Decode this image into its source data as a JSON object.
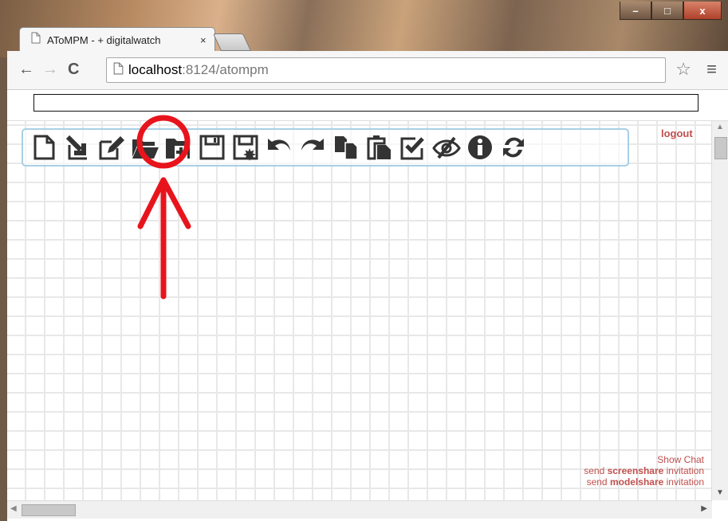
{
  "browser": {
    "tab_title": "AToMPM - + digitalwatch",
    "tab_close": "×",
    "url_host": "localhost",
    "url_path": ":8124/atompm",
    "window_controls": [
      "–",
      "□",
      "x"
    ]
  },
  "nav": {
    "back": "←",
    "forward": "→",
    "reload": "C",
    "star": "☆",
    "menu": "≡"
  },
  "toolbar_icons": [
    "new-model-icon",
    "load-into-icon",
    "edit-icon",
    "open-folder-icon",
    "new-folder-icon",
    "save-icon",
    "save-as-icon",
    "undo-icon",
    "redo-icon",
    "copy-icon",
    "paste-icon",
    "validate-icon",
    "hide-icon",
    "info-icon",
    "refresh-icon"
  ],
  "app": {
    "logout": "logout",
    "show_chat": "Show Chat",
    "screenshare_prefix": "send ",
    "screenshare_bold": "screenshare",
    "screenshare_suffix": " invitation",
    "modelshare_prefix": "send ",
    "modelshare_bold": "modelshare",
    "modelshare_suffix": " invitation"
  },
  "colors": {
    "link_red": "#c0504d",
    "annotation_red": "#e8141c",
    "iconbar_border": "#a8cfe6"
  }
}
